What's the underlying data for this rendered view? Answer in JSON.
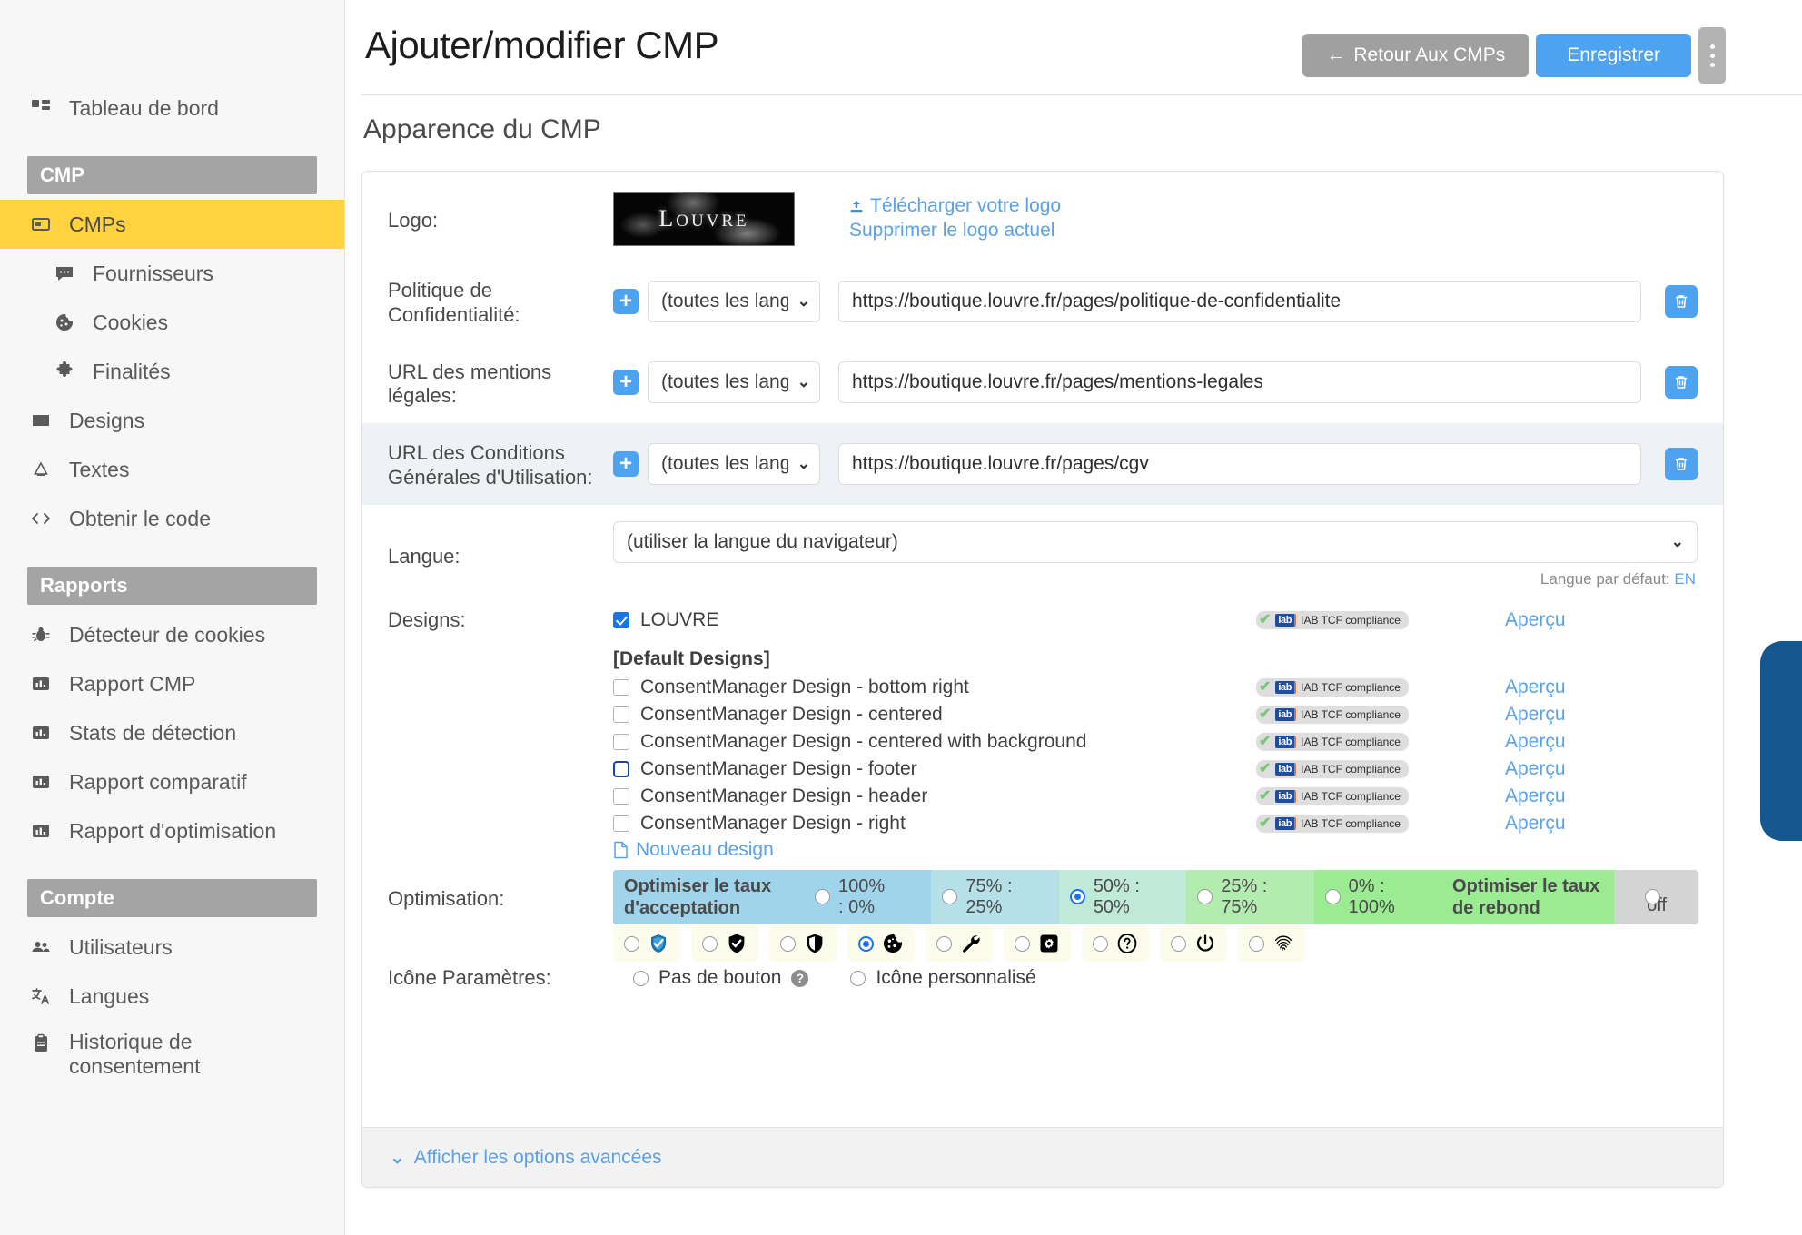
{
  "header": {
    "title": "Ajouter/modifier CMP",
    "subtitle": "Apparence du CMP",
    "back_label": "Retour Aux CMPs",
    "save_label": "Enregistrer",
    "back_arrow": "←"
  },
  "sidebar": {
    "top": [
      {
        "label": "Tableau de bord",
        "icon": "dashboard-icon"
      }
    ],
    "sections": [
      {
        "title": "CMP",
        "items": [
          {
            "label": "CMPs",
            "icon": "cmp-icon",
            "active": true,
            "sub": false
          },
          {
            "label": "Fournisseurs",
            "icon": "vendors-icon",
            "active": false,
            "sub": true
          },
          {
            "label": "Cookies",
            "icon": "cookie-icon",
            "active": false,
            "sub": true
          },
          {
            "label": "Finalités",
            "icon": "puzzle-icon",
            "active": false,
            "sub": true
          },
          {
            "label": "Designs",
            "icon": "image-icon",
            "active": false,
            "sub": false
          },
          {
            "label": "Textes",
            "icon": "text-icon",
            "active": false,
            "sub": false
          },
          {
            "label": "Obtenir le code",
            "icon": "code-icon",
            "active": false,
            "sub": false
          }
        ]
      },
      {
        "title": "Rapports",
        "items": [
          {
            "label": "Détecteur de cookies",
            "icon": "bug-icon",
            "active": false,
            "sub": false
          },
          {
            "label": "Rapport CMP",
            "icon": "chart-icon",
            "active": false,
            "sub": false
          },
          {
            "label": "Stats de détection",
            "icon": "chart-icon",
            "active": false,
            "sub": false
          },
          {
            "label": "Rapport comparatif",
            "icon": "chart-icon",
            "active": false,
            "sub": false
          },
          {
            "label": "Rapport d'optimisation",
            "icon": "chart-icon",
            "active": false,
            "sub": false
          }
        ]
      },
      {
        "title": "Compte",
        "items": [
          {
            "label": "Utilisateurs",
            "icon": "users-icon",
            "active": false,
            "sub": false
          },
          {
            "label": "Langues",
            "icon": "translate-icon",
            "active": false,
            "sub": false
          },
          {
            "label": "Historique de consentement",
            "icon": "clipboard-icon",
            "active": false,
            "sub": false
          }
        ]
      }
    ]
  },
  "form": {
    "logo": {
      "label": "Logo:",
      "logo_text_first": "L",
      "logo_text_rest": "OUVRE",
      "upload_label": "Télécharger votre logo",
      "delete_label": "Supprimer le logo actuel"
    },
    "url_rows": [
      {
        "label": "Politique de Confidentialité:",
        "lang_value": "(toutes les langu",
        "url_value": "https://boutique.louvre.fr/pages/politique-de-confidentialite"
      },
      {
        "label": "URL des mentions légales:",
        "lang_value": "(toutes les langu",
        "url_value": "https://boutique.louvre.fr/pages/mentions-legales"
      },
      {
        "label": "URL des Conditions Générales d'Utilisation:",
        "lang_value": "(toutes les langu",
        "url_value": "https://boutique.louvre.fr/pages/cgv"
      }
    ],
    "langue": {
      "label": "Langue:",
      "value": "(utiliser la langue du navigateur)",
      "default_prefix": "Langue par défaut: ",
      "default_value": "EN"
    },
    "designs": {
      "label": "Designs:",
      "custom": {
        "name": "LOUVRE",
        "checked": true,
        "badge": "IAB TCF compliance",
        "apercu": "Aperçu"
      },
      "group_title": "[Default Designs]",
      "items": [
        {
          "name": "ConsentManager Design - bottom right",
          "checked": false,
          "focused": false,
          "badge": "IAB TCF compliance",
          "apercu": "Aperçu"
        },
        {
          "name": "ConsentManager Design - centered",
          "checked": false,
          "focused": false,
          "badge": "IAB TCF compliance",
          "apercu": "Aperçu"
        },
        {
          "name": "ConsentManager Design - centered with background",
          "checked": false,
          "focused": false,
          "badge": "IAB TCF compliance",
          "apercu": "Aperçu"
        },
        {
          "name": "ConsentManager Design - footer",
          "checked": false,
          "focused": true,
          "badge": "IAB TCF compliance",
          "apercu": "Aperçu"
        },
        {
          "name": "ConsentManager Design - header",
          "checked": false,
          "focused": false,
          "badge": "IAB TCF compliance",
          "apercu": "Aperçu"
        },
        {
          "name": "ConsentManager Design - right",
          "checked": false,
          "focused": false,
          "badge": "IAB TCF compliance",
          "apercu": "Aperçu"
        }
      ],
      "new_design_label": "Nouveau design",
      "iab_logo_text": "iab"
    },
    "optimisation": {
      "label": "Optimisation:",
      "left_caption": "Optimiser le taux d'acceptation",
      "right_caption": "Optimiser le taux de rebond",
      "options": [
        {
          "line1": "100%",
          "line2": ": 0%",
          "selected": false,
          "color": "#9fd4ea"
        },
        {
          "line1": "75% :",
          "line2": "25%",
          "selected": false,
          "color": "#b5e0e8"
        },
        {
          "line1": "50% :",
          "line2": "50%",
          "selected": true,
          "color": "#bfe9d8"
        },
        {
          "line1": "25% :",
          "line2": "75%",
          "selected": false,
          "color": "#b3ecaf"
        },
        {
          "line1": "0% :",
          "line2": "100%",
          "selected": false,
          "color": "#9aeb92"
        }
      ],
      "off_label": "off",
      "off_selected": false
    },
    "icon_settings": {
      "label": "Icône Paramètres:",
      "icons": [
        {
          "name": "shield-check-blue-icon",
          "selected": false
        },
        {
          "name": "shield-check-solid-icon",
          "selected": false
        },
        {
          "name": "shield-half-icon",
          "selected": false
        },
        {
          "name": "cookie-icon",
          "selected": true
        },
        {
          "name": "wrench-icon",
          "selected": false
        },
        {
          "name": "gear-square-icon",
          "selected": false
        },
        {
          "name": "question-circle-icon",
          "selected": false
        },
        {
          "name": "power-icon",
          "selected": false
        },
        {
          "name": "fingerprint-icon",
          "selected": false
        }
      ],
      "no_button_label": "Pas de bouton",
      "custom_icon_label": "Icône personnalisé"
    },
    "advanced_label": "Afficher les options avancées"
  }
}
